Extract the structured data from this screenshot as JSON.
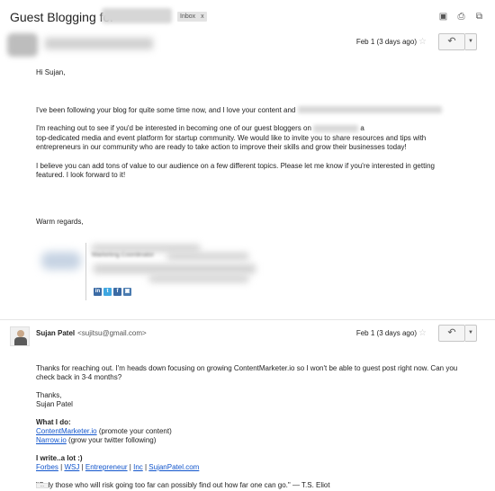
{
  "subject": {
    "title": "Guest Blogging for",
    "badge": "Inbox",
    "badge_close": "x"
  },
  "toolbar_icons": [
    "archive-icon",
    "print-icon",
    "new-window-icon"
  ],
  "message1": {
    "date": "Feb 1 (3 days ago)",
    "greeting": "Hi Sujan,",
    "para1_visible": "I've been following your blog for quite some time now, and I love your content and",
    "para1_blurred": "the lessons you share with your readers.",
    "para2_visible": "I'm reaching out to see if you'd be interested in becoming one of our guest bloggers on",
    "para2_tail": "a",
    "para2_line2": "top-dedicated media and event platform for startup community. We would like to invite you to share resources and tips with",
    "para2_line3": "entrepreneurs in our community who are ready to take action to improve their skills and grow their businesses today!",
    "para3": "I believe you can add tons of value to our audience on a few different topics. Please let me know if you're interested in getting featured. I look forward to it!",
    "signoff": "Warm regards,",
    "sig_title": "Marketing Coordinator",
    "social_icons": [
      "linkedin-icon",
      "twitter-icon",
      "facebook-icon",
      "instagram-icon"
    ]
  },
  "message2": {
    "sender_name": "Sujan Patel",
    "sender_email": "<sujitsu@gmail.com>",
    "date": "Feb 1 (3 days ago)",
    "reply_para": "Thanks for reaching out. I'm heads down focusing on growing ContentMarketer.io so I won't be able to guest post right now. Can you check back in 3-4 months?",
    "thanks": "Thanks,",
    "name": "Sujan Patel",
    "what_i_do": "What I do:",
    "link1": "ContentMarketer.io",
    "link1_note": "(promote your content)",
    "link2": "Narrow.io",
    "link2_note": "(grow your twitter following)",
    "write_label": "I write..a lot :)",
    "pubs": [
      "Forbes",
      "WSJ",
      "Entrepreneur",
      "Inc",
      "SujanPatel.com"
    ],
    "quote": "\"Only those who will risk going too far can possibly find out how far one can go.\" — T.S. Eliot",
    "trimmed": "..."
  }
}
